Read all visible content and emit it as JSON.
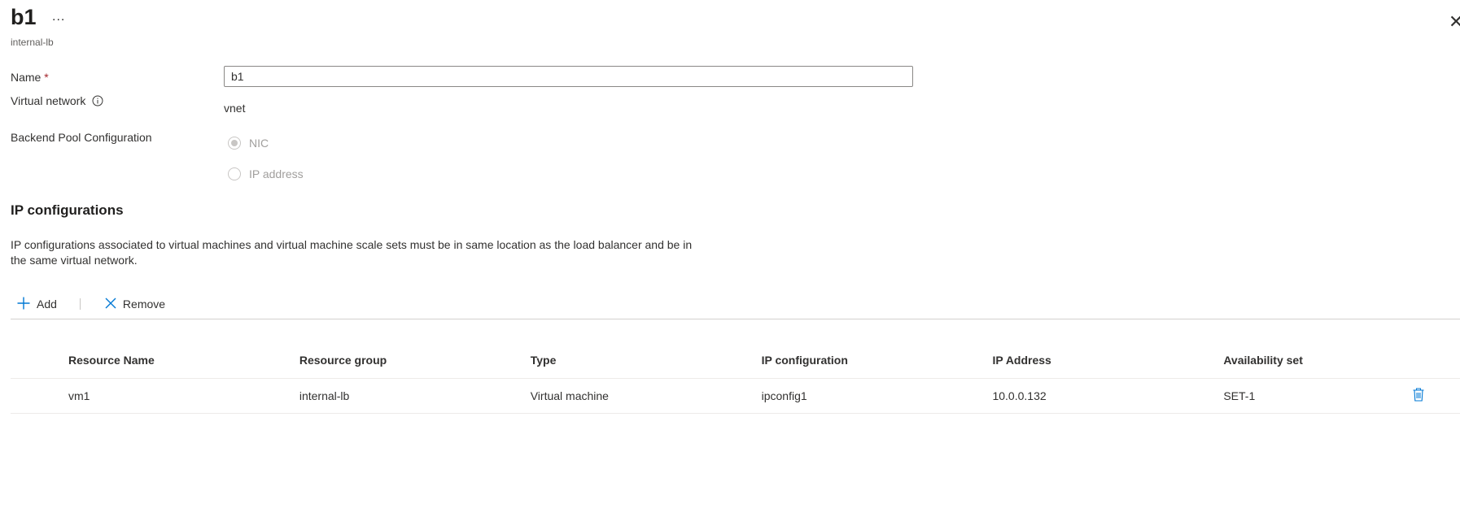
{
  "header": {
    "title": "b1",
    "more": "...",
    "subtitle": "internal-lb",
    "close": "✕"
  },
  "form": {
    "name_label": "Name",
    "required_mark": "*",
    "name_value": "b1",
    "vnet_label": "Virtual network",
    "vnet_value": "vnet",
    "pool_label": "Backend Pool Configuration",
    "pool_options": [
      {
        "label": "NIC",
        "selected": true
      },
      {
        "label": "IP address",
        "selected": false
      }
    ]
  },
  "ipconfig": {
    "heading": "IP configurations",
    "description": "IP configurations associated to virtual machines and virtual machine scale sets must be in same location as the load balancer and be in the same virtual network.",
    "toolbar": {
      "add_label": "Add",
      "remove_label": "Remove"
    },
    "columns": [
      "Resource Name",
      "Resource group",
      "Type",
      "IP configuration",
      "IP Address",
      "Availability set"
    ],
    "rows": [
      [
        "vm1",
        "internal-lb",
        "Virtual machine",
        "ipconfig1",
        "10.0.0.132",
        "SET-1"
      ]
    ]
  },
  "colors": {
    "accent": "#0078d4",
    "required": "#a4262c",
    "disabled": "#a19f9d"
  },
  "icons": {
    "info": "info-icon",
    "add": "plus-icon",
    "remove": "close-icon",
    "delete": "trash-icon"
  }
}
